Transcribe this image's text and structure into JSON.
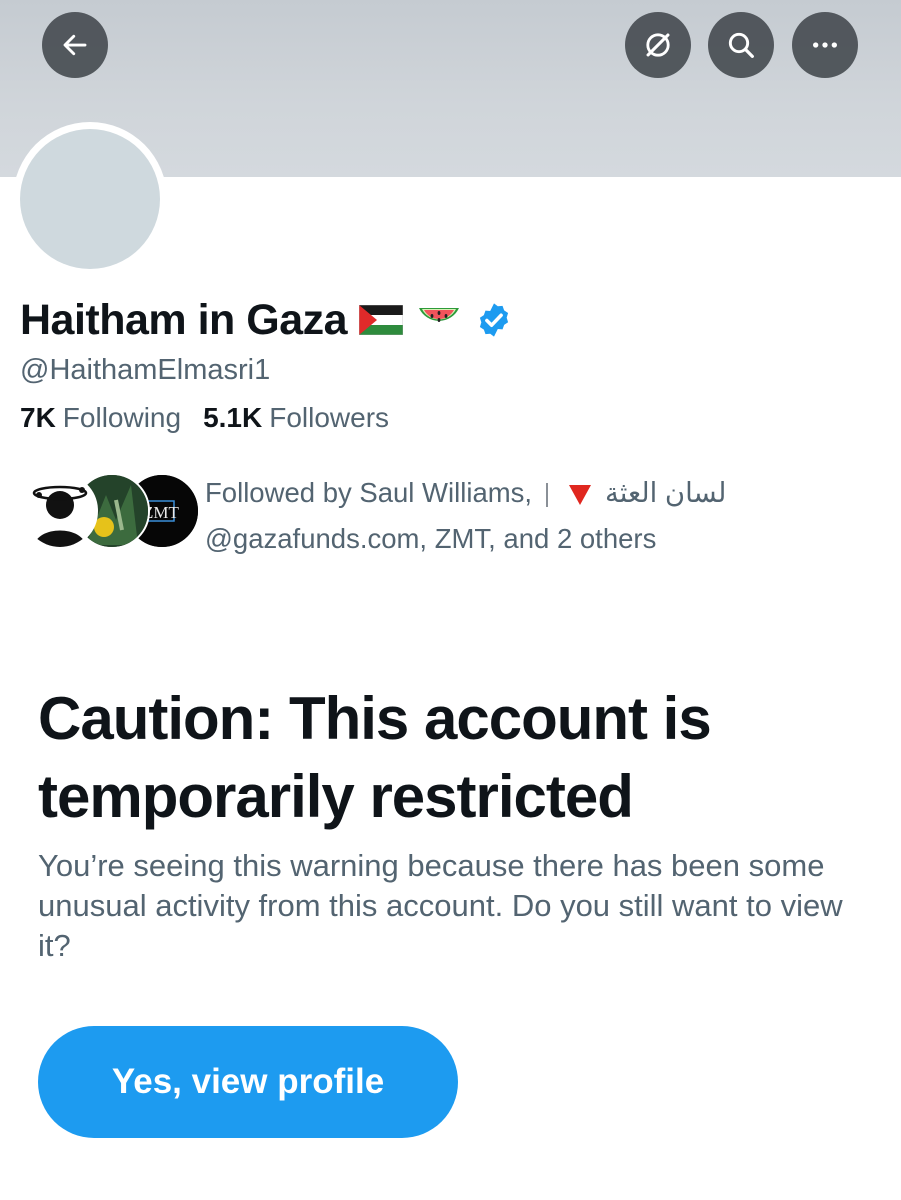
{
  "header": {
    "back_icon": "arrow-left-icon",
    "grok_icon": "grok-slash-circle-icon",
    "search_icon": "search-icon",
    "more_icon": "more-horizontal-icon",
    "banner_color": "#c9cfd4"
  },
  "profile": {
    "display_name": "Haitham in Gaza",
    "name_emojis": [
      "palestine-flag-icon",
      "watermelon-icon"
    ],
    "verified_icon": "verified-badge-icon",
    "handle": "@HaithamElmasri1",
    "following_count": "7K",
    "following_label": "Following",
    "followers_count": "5.1K",
    "followers_label": "Followers"
  },
  "followed_by": {
    "line1_prefix": "Followed by Saul Williams,",
    "line1_rtl": "لسان العثة",
    "line2": "@gazafunds.com, ZMT, and 2 others",
    "mini_avatar_text": "ZMT"
  },
  "caution": {
    "title": "Caution: This account is temporarily restricted",
    "body": "You’re seeing this warning because there has been some unusual activity from this account. Do you still want to view it?",
    "button_label": "Yes, view profile"
  },
  "colors": {
    "accent": "#1d9bf0",
    "secondary_text": "#536471",
    "primary_text": "#0f1419"
  }
}
